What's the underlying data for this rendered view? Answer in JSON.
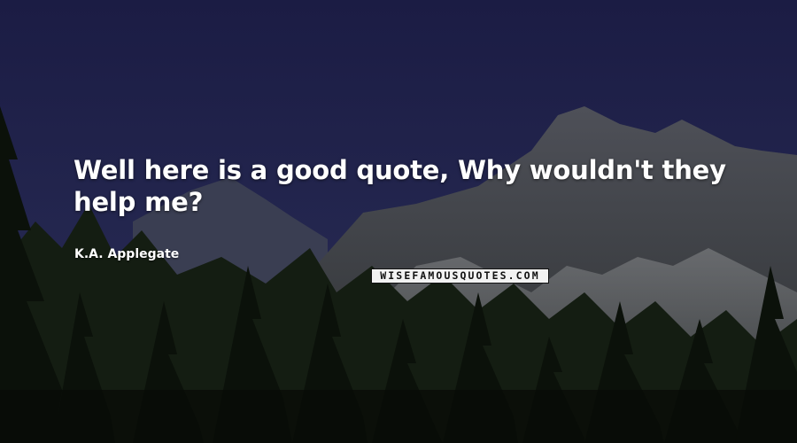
{
  "quote": {
    "text": "Well here is a good quote, Why wouldn't they help me?",
    "author": "K.A. Applegate"
  },
  "watermark": {
    "text": "WISEFAMOUSQUOTES.COM"
  },
  "scene": {
    "description_colors": {
      "sky_top": "#1c1d45",
      "sky_bottom": "#2a2d5a",
      "rock": "#5a5c64",
      "forest": "#0f160e"
    }
  }
}
